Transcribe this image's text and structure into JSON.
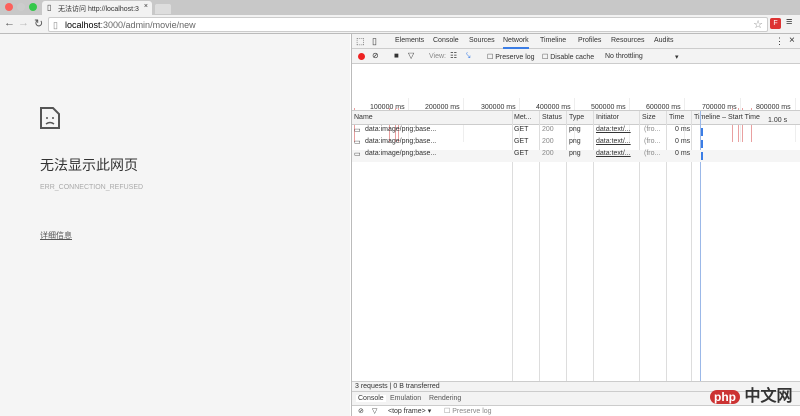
{
  "browser": {
    "tab_title": "无法访问 http://localhost:3",
    "url_host": "localhost",
    "url_path": ":3000/admin/movie/new"
  },
  "page": {
    "title": "无法显示此网页",
    "error_code": "ERR_CONNECTION_REFUSED",
    "details_link": "详细信息"
  },
  "devtools": {
    "tabs": [
      "Elements",
      "Console",
      "Sources",
      "Network",
      "Timeline",
      "Profiles",
      "Resources",
      "Audits"
    ],
    "active_tab": "Network",
    "toolbar": {
      "view_label": "View:",
      "preserve_log": "Preserve log",
      "disable_cache": "Disable cache",
      "throttling": "No throttling"
    },
    "overview_ticks": [
      "100000 ms",
      "200000 ms",
      "300000 ms",
      "400000 ms",
      "500000 ms",
      "600000 ms",
      "700000 ms",
      "800000 ms"
    ],
    "columns": [
      "Name",
      "Met...",
      "Status",
      "Type",
      "Initiator",
      "Size",
      "Time",
      "Timeline – Start Time",
      "1.00 s"
    ],
    "rows": [
      {
        "name": "data:image/png;base...",
        "method": "GET",
        "status": "200",
        "type": "png",
        "initiator": "data:text/...",
        "size": "(fro...",
        "time": "0 ms"
      },
      {
        "name": "data:image/png;base...",
        "method": "GET",
        "status": "200",
        "type": "png",
        "initiator": "data:text/...",
        "size": "(fro...",
        "time": "0 ms"
      },
      {
        "name": "data:image/png;base...",
        "method": "GET",
        "status": "200",
        "type": "png",
        "initiator": "data:text/...",
        "size": "(fro...",
        "time": "0 ms"
      }
    ],
    "status_bar": "3 requests | 0 B transferred",
    "drawer_tabs": [
      "Console",
      "Emulation",
      "Rendering"
    ],
    "drawer_frame": "<top frame>",
    "drawer_preserve": "Preserve log"
  },
  "watermark": "php 中文网"
}
